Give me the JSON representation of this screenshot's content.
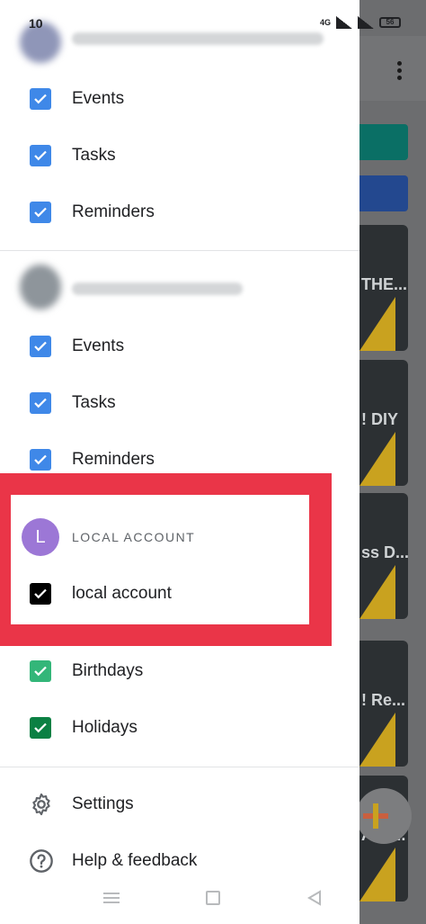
{
  "status_bar": {
    "time": "10",
    "network": "4G",
    "battery": "56"
  },
  "background": {
    "card_labels": [
      "THE...",
      "! DIY",
      "ss D...",
      "! Re...",
      "A VI..."
    ],
    "colors": {
      "teal": "#0a8f80",
      "blue": "#2b63cc"
    }
  },
  "accounts": [
    {
      "items": [
        {
          "label": "Events"
        },
        {
          "label": "Tasks"
        },
        {
          "label": "Reminders"
        }
      ]
    },
    {
      "items": [
        {
          "label": "Events"
        },
        {
          "label": "Tasks"
        },
        {
          "label": "Reminders"
        }
      ]
    }
  ],
  "local_account": {
    "avatar_letter": "L",
    "title": "LOCAL ACCOUNT",
    "item_label": "local account",
    "avatar_color": "#9c77d6",
    "checkbox_color": "#000000"
  },
  "other_calendars": [
    {
      "label": "Birthdays",
      "color": "#33b679"
    },
    {
      "label": "Holidays",
      "color": "#0b8043"
    }
  ],
  "menu": {
    "settings": {
      "label": "Settings",
      "icon": "gear-icon"
    },
    "help": {
      "label": "Help & feedback",
      "icon": "help-icon"
    }
  },
  "colors": {
    "checkbox_blue": "#3f88e8",
    "highlight": "#ea3548"
  }
}
